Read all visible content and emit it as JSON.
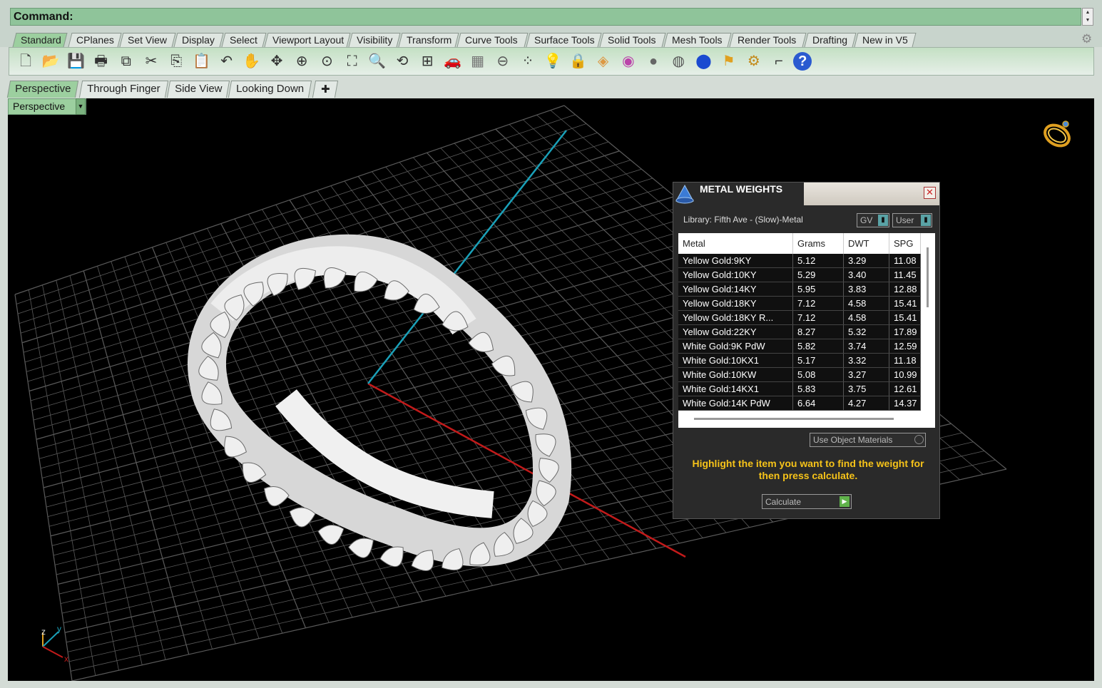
{
  "command": {
    "label": "Command:"
  },
  "toolbar_tabs": [
    "Standard",
    "CPlanes",
    "Set View",
    "Display",
    "Select",
    "Viewport Layout",
    "Visibility",
    "Transform",
    "Curve Tools",
    "Surface Tools",
    "Solid Tools",
    "Mesh Tools",
    "Render Tools",
    "Drafting",
    "New in V5"
  ],
  "toolbar_icons": [
    "new-file-icon",
    "open-folder-icon",
    "save-icon",
    "print-icon",
    "copy-to-clipboard-icon",
    "cut-icon",
    "copy-icon",
    "paste-icon",
    "undo-icon",
    "pan-hand-icon",
    "rotate-view-icon",
    "zoom-dynamic-icon",
    "zoom-window-icon",
    "zoom-extents-icon",
    "zoom-selected-icon",
    "undo-view-icon",
    "four-viewports-icon",
    "car-icon",
    "grid-icon",
    "cplane-icon",
    "points-on-icon",
    "light-bulb-icon",
    "lock-icon",
    "layers-icon",
    "color-wheel-icon",
    "sphere-shaded-icon",
    "sphere-rendered-icon",
    "sphere-blue-icon",
    "spotlight-icon",
    "gear-icon",
    "dimension-icon",
    "help-icon"
  ],
  "viewport_tabs": [
    "Perspective",
    "Through Finger",
    "Side View",
    "Looking Down"
  ],
  "viewport": {
    "label": "Perspective"
  },
  "metal_weights": {
    "title": "METAL WEIGHTS",
    "library": "Library: Fifth Ave - (Slow)-Metal",
    "combo_gv": "GV",
    "combo_user": "User",
    "columns": [
      "Metal",
      "Grams",
      "DWT",
      "SPG"
    ],
    "rows": [
      [
        "Yellow Gold:9KY",
        "5.12",
        "3.29",
        "11.08"
      ],
      [
        "Yellow Gold:10KY",
        "5.29",
        "3.40",
        "11.45"
      ],
      [
        "Yellow Gold:14KY",
        "5.95",
        "3.83",
        "12.88"
      ],
      [
        "Yellow Gold:18KY",
        "7.12",
        "4.58",
        "15.41"
      ],
      [
        "Yellow Gold:18KY R...",
        "7.12",
        "4.58",
        "15.41"
      ],
      [
        "Yellow Gold:22KY",
        "8.27",
        "5.32",
        "17.89"
      ],
      [
        "White Gold:9K PdW",
        "5.82",
        "3.74",
        "12.59"
      ],
      [
        "White Gold:10KX1",
        "5.17",
        "3.32",
        "11.18"
      ],
      [
        "White Gold:10KW",
        "5.08",
        "3.27",
        "10.99"
      ],
      [
        "White Gold:14KX1",
        "5.83",
        "3.75",
        "12.61"
      ],
      [
        "White Gold:14K PdW",
        "6.64",
        "4.27",
        "14.37"
      ]
    ],
    "use_object_materials": "Use Object Materials",
    "hint": "Highlight the item you want to find the weight for then press calculate.",
    "calculate": "Calculate"
  },
  "axis_labels": {
    "z": "z",
    "y": "y",
    "x": "x"
  },
  "colors": {
    "command_bg": "#8fc49a",
    "active_tab": "#9ccf9f",
    "panel_bg": "#2a2a2a",
    "hint_text": "#f6c319",
    "x_axis": "#c21a1a",
    "y_axis": "#1aa0b8",
    "grid": "#5a5a5a"
  }
}
